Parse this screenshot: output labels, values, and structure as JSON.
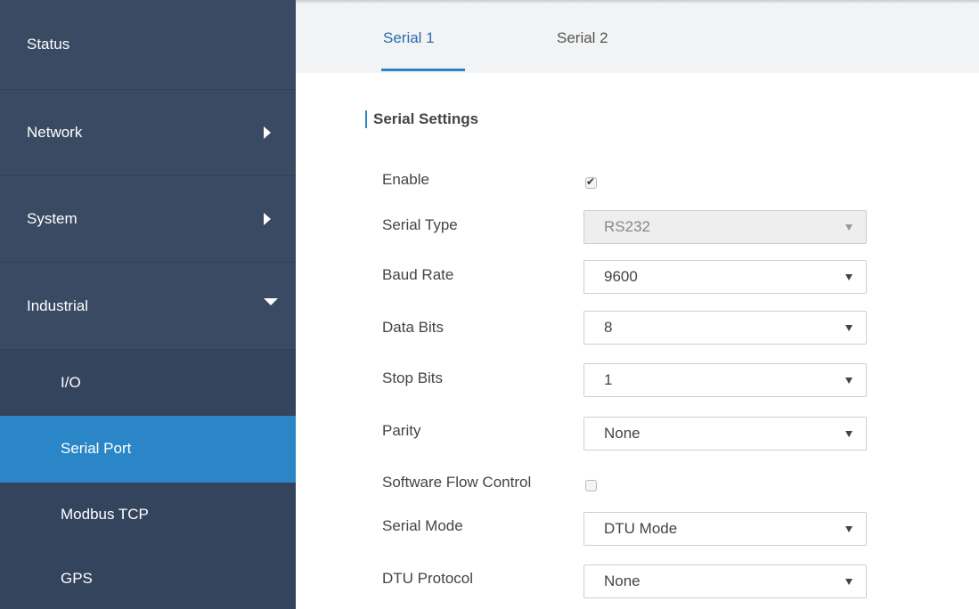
{
  "sidebar": {
    "items": [
      {
        "label": "Status"
      },
      {
        "label": "Network"
      },
      {
        "label": "System"
      },
      {
        "label": "Industrial"
      },
      {
        "label": "I/O"
      },
      {
        "label": "Serial Port"
      },
      {
        "label": "Modbus TCP"
      },
      {
        "label": "GPS"
      }
    ]
  },
  "tabs": [
    {
      "label": "Serial 1",
      "active": true
    },
    {
      "label": "Serial 2",
      "active": false
    }
  ],
  "section": {
    "title": "Serial Settings"
  },
  "form": {
    "enable": {
      "label": "Enable",
      "checked": true
    },
    "serial_type": {
      "label": "Serial Type",
      "value": "RS232",
      "disabled": true
    },
    "baud_rate": {
      "label": "Baud Rate",
      "value": "9600"
    },
    "data_bits": {
      "label": "Data Bits",
      "value": "8"
    },
    "stop_bits": {
      "label": "Stop Bits",
      "value": "1"
    },
    "parity": {
      "label": "Parity",
      "value": "None"
    },
    "software_flow_control": {
      "label": "Software Flow Control",
      "checked": false
    },
    "serial_mode": {
      "label": "Serial Mode",
      "value": "DTU Mode"
    },
    "dtu_protocol": {
      "label": "DTU Protocol",
      "value": "None"
    }
  },
  "colors": {
    "sidebar_bg": "#3a4a63",
    "active_item": "#2b86c7",
    "accent": "#2b86c7"
  }
}
